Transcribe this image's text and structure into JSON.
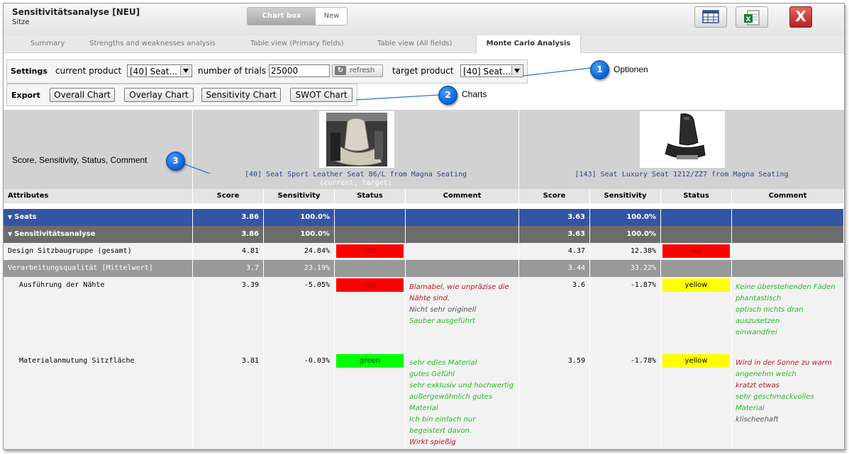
{
  "window": {
    "title": "Sensitivitätsanalyse [NEU]",
    "subtitle": "Sitze",
    "toggle_on": "Chart box",
    "toggle_off": "New",
    "close_label": "X"
  },
  "tabs": [
    {
      "label": "Summary"
    },
    {
      "label": "Strengths and weaknesses analysis"
    },
    {
      "label": "Table view (Primary fields)"
    },
    {
      "label": "Table view (All fields)"
    },
    {
      "label": "Monte Carlo Analysis",
      "active": true
    }
  ],
  "settings": {
    "label": "Settings",
    "current_product_label": "current product",
    "current_product_value": "[40] Seat...",
    "trials_label": "number of trials",
    "trials_value": "25000",
    "refresh_label": "refresh",
    "target_product_label": "target product",
    "target_product_value": "[40] Seat..."
  },
  "export": {
    "label": "Export",
    "buttons": [
      "Overall Chart",
      "Overlay Chart",
      "Sensitivity Chart",
      "SWOT Chart"
    ]
  },
  "callouts": [
    {
      "number": "1",
      "text": "Optionen"
    },
    {
      "number": "2",
      "text": "Charts"
    },
    {
      "number": "3",
      "text": ""
    }
  ],
  "header": {
    "summary_label": "Score, Sensitivity, Status, Comment",
    "products": [
      {
        "name": "[40] Seat Sport Leather Seat 86/L from Magna Seating",
        "note": "(current, target)"
      },
      {
        "name": "[143] Seat Luxury Seat 1212/ZZ7 from Magna Seating",
        "note": ""
      }
    ],
    "columns": {
      "attributes": "Attributes",
      "score": "Score",
      "sensitivity": "Sensitivity",
      "status": "Status",
      "comment": "Comment"
    }
  },
  "colors": {
    "group_row": "#3455a4",
    "subgroup_row": "#6c6c6c",
    "avg_row": "#999999",
    "status_red": "#ff0000",
    "status_green": "#00ff00",
    "status_yellow": "#ffff00",
    "callout": "#0a5fd0"
  },
  "rows": [
    {
      "label": "Seats",
      "p1": {
        "score": "3.86",
        "sens": "100.0%",
        "status": "",
        "comments": []
      },
      "p2": {
        "score": "3.63",
        "sens": "100.0%",
        "status": "",
        "comments": []
      }
    },
    {
      "label": "Sensitivitätsanalyse",
      "p1": {
        "score": "3.86",
        "sens": "100.0%",
        "status": "",
        "comments": []
      },
      "p2": {
        "score": "3.63",
        "sens": "100.0%",
        "status": "",
        "comments": []
      }
    },
    {
      "label": "Design Sitzbaugruppe (gesamt)",
      "p1": {
        "score": "4.81",
        "sens": "24.84%",
        "status": "red",
        "comments": []
      },
      "p2": {
        "score": "4.37",
        "sens": "12.38%",
        "status": "red",
        "comments": []
      }
    },
    {
      "label": "Verarbeitungsqualität [Mittelwert]",
      "p1": {
        "score": "3.7",
        "sens": "23.19%",
        "status": "",
        "comments": []
      },
      "p2": {
        "score": "3.44",
        "sens": "33.22%",
        "status": "",
        "comments": []
      }
    },
    {
      "label": "Ausführung der Nähte",
      "p1": {
        "score": "3.39",
        "sens": "-5.05%",
        "status": "red",
        "comments": [
          {
            "text": "Blamabel, wie unpräzise die",
            "tone": "red"
          },
          {
            "text": "Nähte sind.",
            "tone": "red"
          },
          {
            "text": "Nicht sehr originell",
            "tone": "gray"
          },
          {
            "text": "Sauber ausgeführt",
            "tone": "green"
          }
        ]
      },
      "p2": {
        "score": "3.6",
        "sens": "-1.87%",
        "status": "yellow",
        "comments": [
          {
            "text": "Keine überstehenden Fäden",
            "tone": "green"
          },
          {
            "text": "phantastisch",
            "tone": "green"
          },
          {
            "text": "optisch nichts dran",
            "tone": "green"
          },
          {
            "text": "auszusetzen",
            "tone": "green"
          },
          {
            "text": "einwandfrei",
            "tone": "green"
          }
        ]
      }
    },
    {
      "label": "Materialanmutung Sitzfläche",
      "p1": {
        "score": "3.81",
        "sens": "-0.03%",
        "status": "green",
        "comments": [
          {
            "text": "sehr edles Material",
            "tone": "green"
          },
          {
            "text": "gutes Gefühl",
            "tone": "green"
          },
          {
            "text": "sehr exklusiv und hochwertig",
            "tone": "green"
          },
          {
            "text": "außergewöhnlich gutes",
            "tone": "green"
          },
          {
            "text": "Material",
            "tone": "green"
          },
          {
            "text": "Ich bin einfach nur",
            "tone": "green"
          },
          {
            "text": "begeistert davon.",
            "tone": "green"
          },
          {
            "text": "Wirkt spießig",
            "tone": "red"
          }
        ]
      },
      "p2": {
        "score": "3.59",
        "sens": "-1.78%",
        "status": "yellow",
        "comments": [
          {
            "text": "Wird in der Sonne zu warm",
            "tone": "red"
          },
          {
            "text": "angenehm weich",
            "tone": "green"
          },
          {
            "text": "kratzt etwas",
            "tone": "red"
          },
          {
            "text": "sehr geschmackvolles",
            "tone": "green"
          },
          {
            "text": "Material",
            "tone": "green"
          },
          {
            "text": "klischeehaft",
            "tone": "gray"
          }
        ]
      }
    }
  ]
}
